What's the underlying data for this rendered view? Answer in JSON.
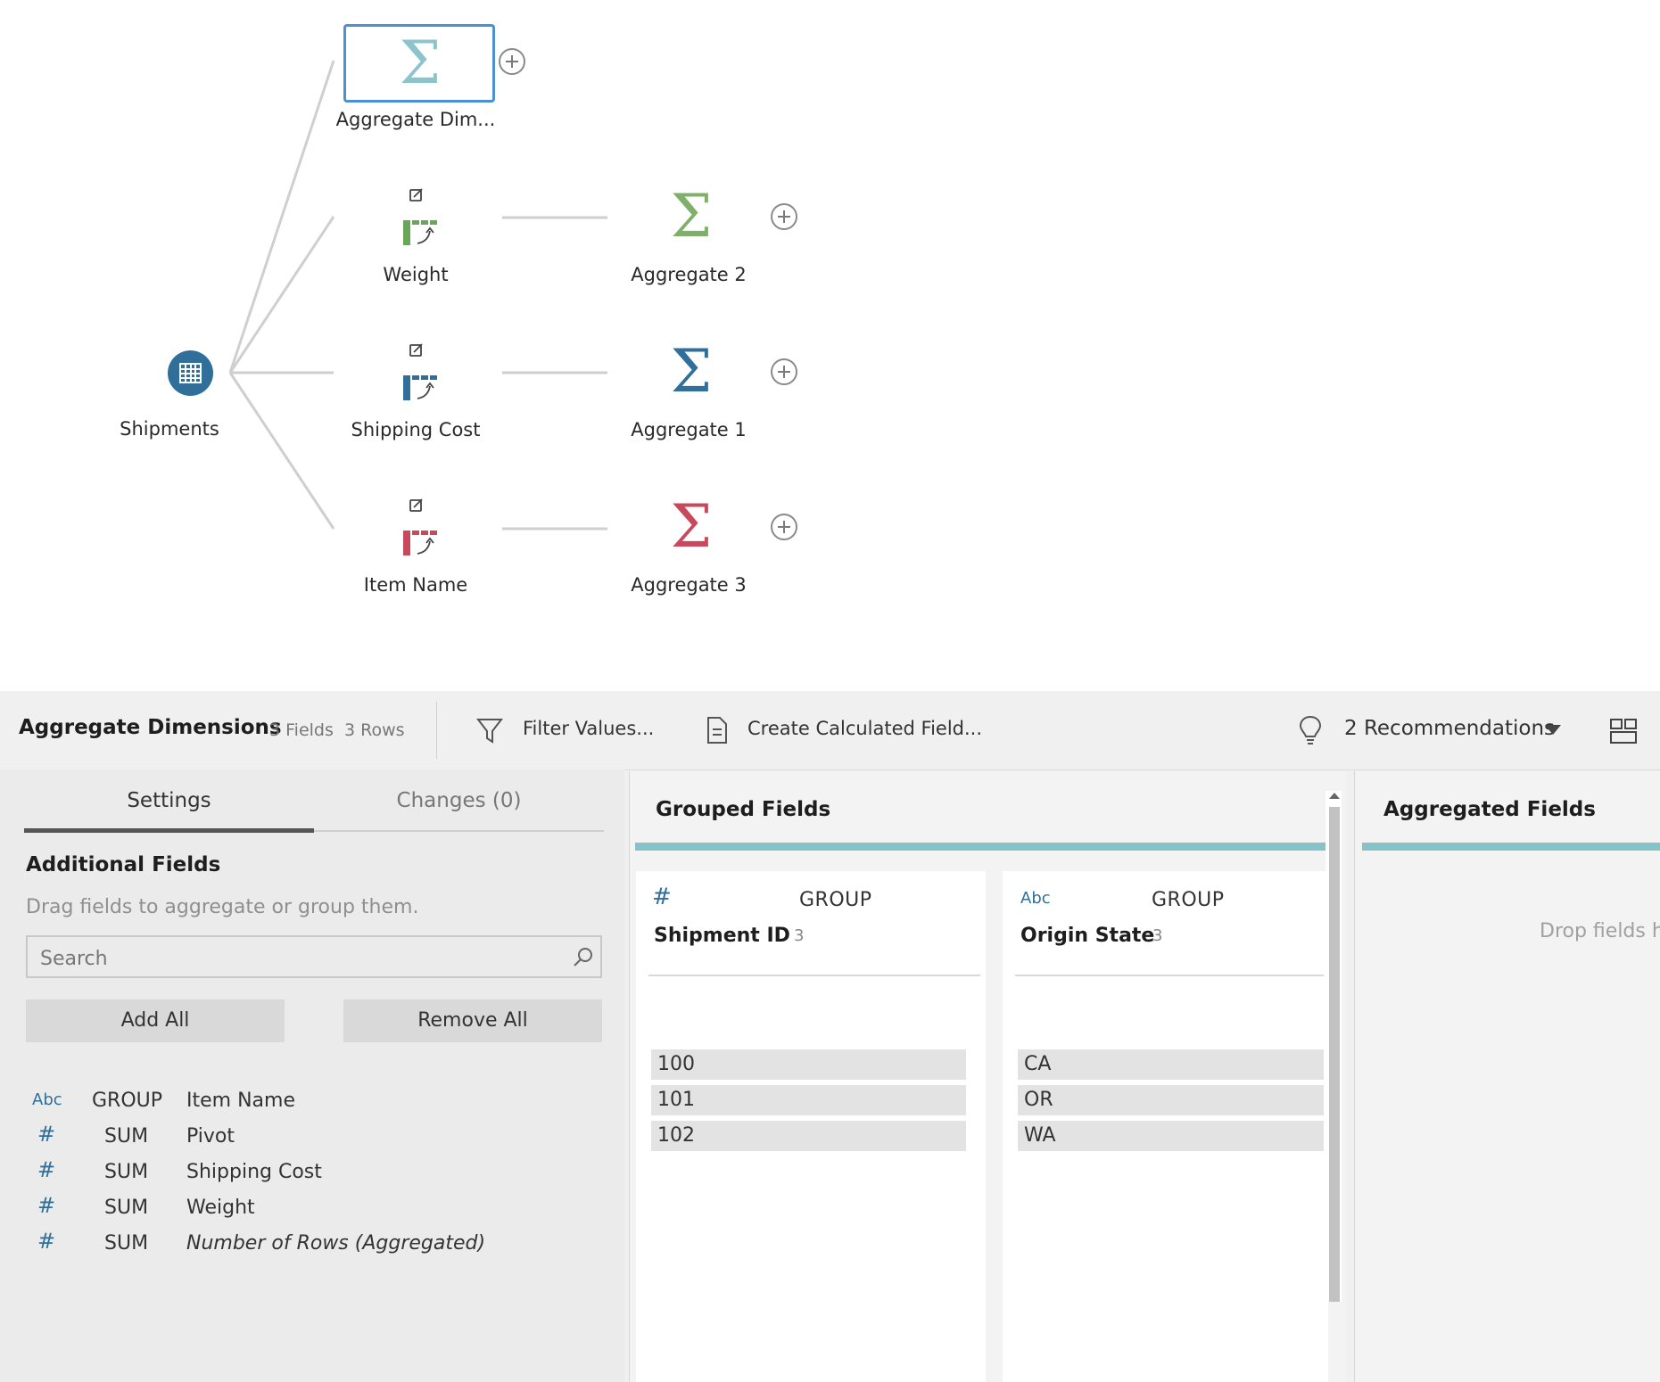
{
  "flow": {
    "input_node": {
      "label": "Shipments"
    },
    "aggregate_dim_node": {
      "label": "Aggregate Dim..."
    },
    "pivot_nodes": [
      {
        "label": "Weight",
        "color": "#6aa65a"
      },
      {
        "label": "Shipping Cost",
        "color": "#2f6f9a"
      },
      {
        "label": "Item Name",
        "color": "#c9485b"
      }
    ],
    "aggregate_nodes": [
      {
        "label": "Aggregate 2",
        "color": "#7fb069"
      },
      {
        "label": "Aggregate 1",
        "color": "#2f6f9a"
      },
      {
        "label": "Aggregate 3",
        "color": "#c9485b"
      }
    ],
    "aggregate_dim_color": "#8cc4cc"
  },
  "toolbar": {
    "step_title": "Aggregate Dimensions",
    "fields_count": "3 Fields",
    "rows_count": "3 Rows",
    "filter_label": "Filter Values...",
    "calc_label": "Create Calculated Field...",
    "recommendations_label": "2 Recommendations"
  },
  "settings": {
    "tab_settings": "Settings",
    "tab_changes": "Changes (0)",
    "section_title": "Additional Fields",
    "hint": "Drag fields to aggregate or group them.",
    "search_placeholder": "Search",
    "add_all": "Add All",
    "remove_all": "Remove All",
    "fields": [
      {
        "type": "Abc",
        "agg": "GROUP",
        "name": "Item Name",
        "italic": false
      },
      {
        "type": "#",
        "agg": "SUM",
        "name": "Pivot",
        "italic": false
      },
      {
        "type": "#",
        "agg": "SUM",
        "name": "Shipping Cost",
        "italic": false
      },
      {
        "type": "#",
        "agg": "SUM",
        "name": "Weight",
        "italic": false
      },
      {
        "type": "#",
        "agg": "SUM",
        "name": "Number of Rows (Aggregated)",
        "italic": true
      }
    ]
  },
  "grouped": {
    "title": "Grouped Fields",
    "columns": [
      {
        "type": "#",
        "role": "GROUP",
        "name": "Shipment ID",
        "count": "3",
        "values": [
          "100",
          "101",
          "102"
        ]
      },
      {
        "type": "Abc",
        "role": "GROUP",
        "name": "Origin State",
        "count": "3",
        "values": [
          "CA",
          "OR",
          "WA"
        ]
      }
    ]
  },
  "aggregated": {
    "title": "Aggregated Fields",
    "drop_hint": "Drop fields h"
  },
  "colors": {
    "accent_teal": "#86c3c9",
    "selection_blue": "#4a90d9",
    "input_blue": "#2f6f9a"
  }
}
